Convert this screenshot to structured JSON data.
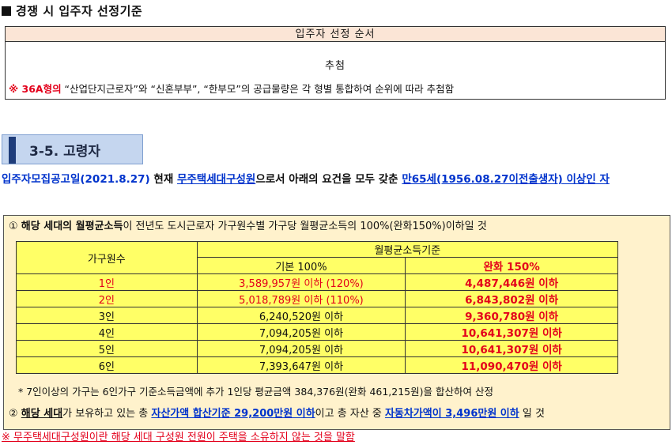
{
  "heading": "경쟁 시 입주자 선정기준",
  "selection_order": {
    "header": "입주자 선정 순서",
    "method": "추첨",
    "note_prefix": "※ 36A형의",
    "note_text": " “산업단지근로자”와 “신혼부부”, “한부모”의 공급물량은 각 형별 통합하여 순위에 따라 추첨함"
  },
  "section": {
    "title": "3-5. 고령자"
  },
  "eligibility": {
    "date_text": "입주자모집공고일(2021.8.27)",
    "text1": " 현재 ",
    "link1": "무주택세대구성원",
    "text2": "으로서 아래의 요건을 모두 갖춘 ",
    "link2": "만65세(1956.08.27이전출생자) 이상인 자"
  },
  "condition1": {
    "prefix": "① ",
    "bold": "해당 세대의 월평균소득",
    "text": "이 전년도 도시근로자 가구원수별 가구당 월평균소득의 100%(완화150%)이하일 것"
  },
  "income_table": {
    "col_household": "가구원수",
    "col_group": "월평균소득기준",
    "col_basic": "기본 100%",
    "col_relaxed": "완화 150%",
    "rows": [
      {
        "members": "1인",
        "basic": "3,589,957원 이하 (120%)",
        "relaxed": "4,487,446원 이하",
        "red": true
      },
      {
        "members": "2인",
        "basic": "5,018,789원 이하 (110%)",
        "relaxed": "6,843,802원 이하",
        "red": true
      },
      {
        "members": "3인",
        "basic": "6,240,520원 이하",
        "relaxed": "9,360,780원 이하",
        "red": false
      },
      {
        "members": "4인",
        "basic": "7,094,205원 이하",
        "relaxed": "10,641,307원 이하",
        "red": false
      },
      {
        "members": "5인",
        "basic": "7,094,205원 이하",
        "relaxed": "10,641,307원 이하",
        "red": false
      },
      {
        "members": "6인",
        "basic": "7,393,647원 이하",
        "relaxed": "11,090,470원 이하",
        "red": false
      }
    ]
  },
  "note_7plus": "* 7인이상의 가구는 6인가구 기준소득금액에 추가 1인당 평균금액 384,376원(완화 461,215원)을 합산하여 산정",
  "condition2": {
    "prefix": "② ",
    "bold": "해당 세대",
    "t1": "가 보유하고 있는 총 ",
    "asset": "자산가액 합산기준 29,200만원 이하",
    "t2": "이고 총 자산 중 ",
    "car": "자동차가액이 3,496만원 이하",
    "t3": " 일 것"
  },
  "footnote": "※ 무주택세대구성원이란 해당 세대 구성원 전원이 주택을 소유하지 않는 것을 말함",
  "colors": {
    "red": "#e3001b",
    "blue": "#0033cc",
    "table_yellow": "#ffff66",
    "box_cream": "#fff2cc",
    "tab_blue": "#c5d6ef"
  }
}
